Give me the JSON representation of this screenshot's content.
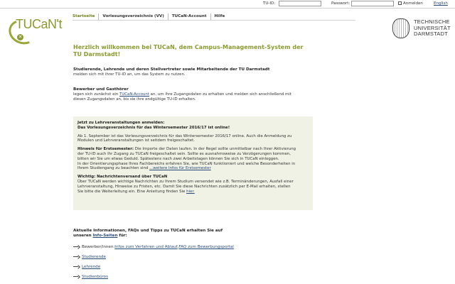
{
  "topbar": {
    "tuid_label": "TU-ID:",
    "password_label": "Passwort:",
    "login_label": "Anmelden",
    "language_link": "English"
  },
  "logo": {
    "text": "TUCaN't",
    "badge": "✕"
  },
  "nav": {
    "items": [
      {
        "label": "Startseite"
      },
      {
        "label": "Vorlesungsverzeichnis (VV)"
      },
      {
        "label": "TUCaN-Account"
      },
      {
        "label": "Hilfe"
      }
    ]
  },
  "university": {
    "line1": "TECHNISCHE",
    "line2": "UNIVERSITÄT",
    "line3": "DARMSTADT"
  },
  "welcome": {
    "title_line1": "Herzlich willkommen bei TUCaN, dem Campus-Management-System der",
    "title_line2": "TU Darmstadt!"
  },
  "students": {
    "heading": "Studierende, Lehrende und deren Stellvertreter sowie Mitarbeitende der TU Darmstadt",
    "text": "melden sich mit ihrer TU-ID an, um das System zu nutzen."
  },
  "applicants": {
    "heading": "Bewerber und Gasthörer",
    "text_before": "legen sich zunächst ein ",
    "link": "TUCaN-Account",
    "text_after": " an, um ihre Zugangsdaten zu erhalten und melden sich anschließend mit",
    "text_line2": "diesen Zugangsdaten an, bis sie ihre endgültige TU-ID erhalten."
  },
  "notice": {
    "h1": "Jetzt zu Lehrveranstaltungen anmelden:",
    "h2": "Das Vorlesungsverzeichnis für das Wintersemester 2016/17 ist online!",
    "p1_l1": "Ab 1. September ist das Vorlesungsverzeichnis für das Wintersemester 2016/17 online. Auch die Anmeldung zu",
    "p1_l2": "Modulen und Lehrveranstaltungen ist seitdem freigeschaltet.",
    "p2_bold": "Hinweis für Erstsemester:",
    "p2_l1": " Die Importe der Daten laufen. In der Regel sollte unmittelbar nach Ihrer Aktivierung",
    "p2_l2": "der TU-ID auch Ihr Zugang zu TUCaN freigeschaltet sein. Sollte es ausnahmsweise zu Verzögerungen kommen,",
    "p2_l3": "bitten wir Sie um etwas Geduld. Spätestens nach zwei Arbeitstagen können Sie sich in TUCaN einloggen.",
    "p2_l4": "In der Orientierungsphase Ihres Fachbereichs erfahren Sie, wie TUCaN funktioniert und welche Besonderheiten in",
    "p2_l5": "Ihrem Studiengang zu beachten sind ",
    "p2_link": "...weitere Infos für Erstsemester",
    "p3_head1": "Wichtig: Nachrichtenversand über TUCaN",
    "p3_l1": "Über TUCaN werden wichtige Nachrichten zu Ihrem Studium versendet wie z.B. Terminänderungen, Ausfall einer",
    "p3_l2": "Lehrveranstaltung, Hinweise zu Fristen, etc. Damit Sie diese Nachrichten zusätzlich per E-Mail erhalten, stellen",
    "p3_l3": "Sie bitte die Weiterleitung ein. Eine Anleitung finden Sie ",
    "p3_link": "hier."
  },
  "info": {
    "heading_l1": "Aktuelle Informationen, FAQs und Tipps zu TUCaN erhalten Sie auf",
    "heading_l2_before": "unseren ",
    "heading_link": "Info-Seiten",
    "heading_l2_after": " für:",
    "applicants_label": "Bewerber/innen: ",
    "applicants_link1": "Infos zum Verfahren und Ablauf",
    "applicants_sep": ", ",
    "applicants_link2": "FAQ zum Bewerbungsportal",
    "links": [
      "Studierende",
      "Lehrende",
      "Studienbüros"
    ]
  }
}
